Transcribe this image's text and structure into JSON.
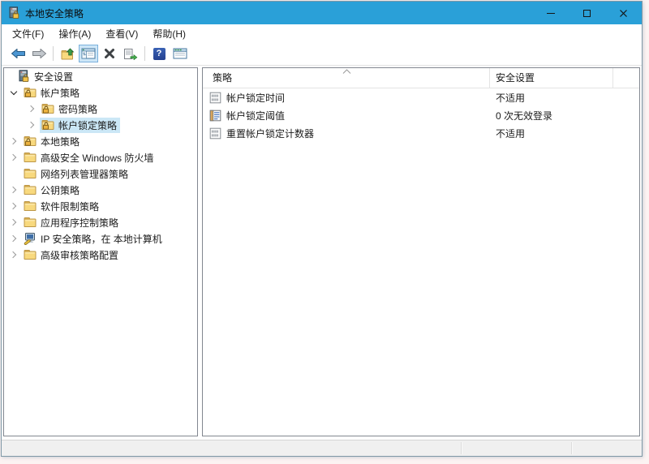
{
  "window": {
    "title": "本地安全策略"
  },
  "titlebar": {
    "controls": [
      "minimize",
      "maximize",
      "close"
    ]
  },
  "menu": {
    "items": [
      {
        "label": "文件(F)"
      },
      {
        "label": "操作(A)"
      },
      {
        "label": "查看(V)"
      },
      {
        "label": "帮助(H)"
      }
    ]
  },
  "toolbar": {
    "help_glyph": "?",
    "buttons": [
      {
        "icon": "back-arrow-icon"
      },
      {
        "icon": "forward-arrow-icon"
      },
      {
        "icon": "folder-up-icon"
      },
      {
        "icon": "console-tree-toggle-icon",
        "toggled": true
      },
      {
        "icon": "delete-x-icon"
      },
      {
        "icon": "export-list-icon"
      },
      {
        "icon": "help-icon"
      },
      {
        "icon": "action-pane-icon"
      }
    ]
  },
  "tree": {
    "items": [
      {
        "label": "安全设置",
        "level": 0,
        "icon": "security-settings",
        "expand": "none",
        "selected": false
      },
      {
        "label": "帐户策略",
        "level": 1,
        "icon": "folder-lock",
        "expand": "expanded",
        "selected": false
      },
      {
        "label": "密码策略",
        "level": 2,
        "icon": "folder-lock",
        "expand": "collapsed",
        "selected": false
      },
      {
        "label": "帐户锁定策略",
        "level": 2,
        "icon": "folder-lock",
        "expand": "collapsed",
        "selected": true
      },
      {
        "label": "本地策略",
        "level": 1,
        "icon": "folder-lock",
        "expand": "collapsed",
        "selected": false
      },
      {
        "label": "高级安全 Windows 防火墙",
        "level": 1,
        "icon": "folder",
        "expand": "collapsed",
        "selected": false
      },
      {
        "label": "网络列表管理器策略",
        "level": 1,
        "icon": "folder",
        "expand": "none",
        "selected": false
      },
      {
        "label": "公钥策略",
        "level": 1,
        "icon": "folder",
        "expand": "collapsed",
        "selected": false
      },
      {
        "label": "软件限制策略",
        "level": 1,
        "icon": "folder",
        "expand": "collapsed",
        "selected": false
      },
      {
        "label": "应用程序控制策略",
        "level": 1,
        "icon": "folder",
        "expand": "collapsed",
        "selected": false
      },
      {
        "label": "IP 安全策略，在 本地计算机",
        "level": 1,
        "icon": "ip-security",
        "expand": "collapsed",
        "selected": false
      },
      {
        "label": "高级审核策略配置",
        "level": 1,
        "icon": "folder",
        "expand": "collapsed",
        "selected": false
      }
    ]
  },
  "list": {
    "columns": [
      {
        "label": "策略",
        "sorted": "ascending"
      },
      {
        "label": "安全设置"
      }
    ],
    "rows": [
      {
        "policy": "帐户锁定时间",
        "setting": "不适用",
        "icon": "policy-undefined"
      },
      {
        "policy": "帐户锁定阈值",
        "setting": "0 次无效登录",
        "icon": "policy-defined"
      },
      {
        "policy": "重置帐户锁定计数器",
        "setting": "不适用",
        "icon": "policy-undefined"
      }
    ]
  },
  "colors": {
    "titlebar": "#2aa0d8",
    "selection": "#cbe7f6",
    "statusbar": "#f0f0f0",
    "pane_border": "#828790"
  }
}
